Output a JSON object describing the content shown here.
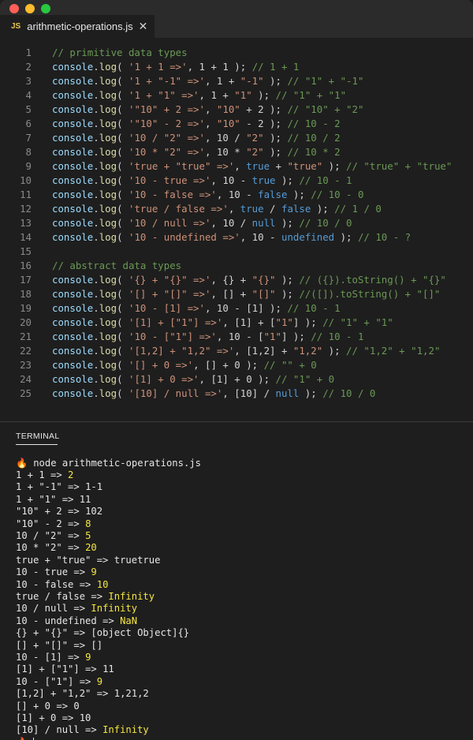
{
  "window": {
    "traffic_lights": [
      {
        "name": "close",
        "color": "#ff5f57"
      },
      {
        "name": "minimize",
        "color": "#febc2e"
      },
      {
        "name": "zoom",
        "color": "#28c840"
      }
    ]
  },
  "tab": {
    "badge": "JS",
    "title": "arithmetic-operations.js",
    "close_icon": "close-icon"
  },
  "editor": {
    "lines": [
      {
        "n": "1",
        "tokens": [
          [
            "c",
            "// primitive data types"
          ]
        ]
      },
      {
        "n": "2",
        "tokens": [
          [
            "i",
            "console"
          ],
          [
            "p",
            "."
          ],
          [
            "f",
            "log"
          ],
          [
            "p",
            "( "
          ],
          [
            "s",
            "'1 + 1 =>'"
          ],
          [
            "p",
            ", "
          ],
          [
            "p",
            "1 + 1"
          ],
          [
            "p",
            " ); "
          ],
          [
            "c",
            "// 1 + 1"
          ]
        ]
      },
      {
        "n": "3",
        "tokens": [
          [
            "i",
            "console"
          ],
          [
            "p",
            "."
          ],
          [
            "f",
            "log"
          ],
          [
            "p",
            "( "
          ],
          [
            "s",
            "'1 + \"-1\" =>'"
          ],
          [
            "p",
            ", "
          ],
          [
            "p",
            "1 + "
          ],
          [
            "s",
            "\"-1\""
          ],
          [
            "p",
            " ); "
          ],
          [
            "c",
            "// \"1\" + \"-1\""
          ]
        ]
      },
      {
        "n": "4",
        "tokens": [
          [
            "i",
            "console"
          ],
          [
            "p",
            "."
          ],
          [
            "f",
            "log"
          ],
          [
            "p",
            "( "
          ],
          [
            "s",
            "'1 + \"1\" =>'"
          ],
          [
            "p",
            ", "
          ],
          [
            "p",
            "1 + "
          ],
          [
            "s",
            "\"1\""
          ],
          [
            "p",
            " ); "
          ],
          [
            "c",
            "// \"1\" + \"1\""
          ]
        ]
      },
      {
        "n": "5",
        "tokens": [
          [
            "i",
            "console"
          ],
          [
            "p",
            "."
          ],
          [
            "f",
            "log"
          ],
          [
            "p",
            "( "
          ],
          [
            "s",
            "'\"10\" + 2 =>'"
          ],
          [
            "p",
            ", "
          ],
          [
            "s",
            "\"10\""
          ],
          [
            "p",
            " + 2 ); "
          ],
          [
            "c",
            "// \"10\" + \"2\""
          ]
        ]
      },
      {
        "n": "6",
        "tokens": [
          [
            "i",
            "console"
          ],
          [
            "p",
            "."
          ],
          [
            "f",
            "log"
          ],
          [
            "p",
            "( "
          ],
          [
            "s",
            "'\"10\" - 2 =>'"
          ],
          [
            "p",
            ", "
          ],
          [
            "s",
            "\"10\""
          ],
          [
            "p",
            " - 2 ); "
          ],
          [
            "c",
            "// 10 - 2"
          ]
        ]
      },
      {
        "n": "7",
        "tokens": [
          [
            "i",
            "console"
          ],
          [
            "p",
            "."
          ],
          [
            "f",
            "log"
          ],
          [
            "p",
            "( "
          ],
          [
            "s",
            "'10 / \"2\" =>'"
          ],
          [
            "p",
            ", "
          ],
          [
            "p",
            "10 / "
          ],
          [
            "s",
            "\"2\""
          ],
          [
            "p",
            " ); "
          ],
          [
            "c",
            "// 10 / 2"
          ]
        ]
      },
      {
        "n": "8",
        "tokens": [
          [
            "i",
            "console"
          ],
          [
            "p",
            "."
          ],
          [
            "f",
            "log"
          ],
          [
            "p",
            "( "
          ],
          [
            "s",
            "'10 * \"2\" =>'"
          ],
          [
            "p",
            ", "
          ],
          [
            "p",
            "10 * "
          ],
          [
            "s",
            "\"2\""
          ],
          [
            "p",
            " ); "
          ],
          [
            "c",
            "// 10 * 2"
          ]
        ]
      },
      {
        "n": "9",
        "tokens": [
          [
            "i",
            "console"
          ],
          [
            "p",
            "."
          ],
          [
            "f",
            "log"
          ],
          [
            "p",
            "( "
          ],
          [
            "s",
            "'true + \"true\" =>'"
          ],
          [
            "p",
            ", "
          ],
          [
            "k",
            "true"
          ],
          [
            "p",
            " + "
          ],
          [
            "s",
            "\"true\""
          ],
          [
            "p",
            " ); "
          ],
          [
            "c",
            "// \"true\" + \"true\""
          ]
        ]
      },
      {
        "n": "10",
        "tokens": [
          [
            "i",
            "console"
          ],
          [
            "p",
            "."
          ],
          [
            "f",
            "log"
          ],
          [
            "p",
            "( "
          ],
          [
            "s",
            "'10 - true =>'"
          ],
          [
            "p",
            ", "
          ],
          [
            "p",
            "10 - "
          ],
          [
            "k",
            "true"
          ],
          [
            "p",
            " ); "
          ],
          [
            "c",
            "// 10 - 1"
          ]
        ]
      },
      {
        "n": "11",
        "tokens": [
          [
            "i",
            "console"
          ],
          [
            "p",
            "."
          ],
          [
            "f",
            "log"
          ],
          [
            "p",
            "( "
          ],
          [
            "s",
            "'10 - false =>'"
          ],
          [
            "p",
            ", "
          ],
          [
            "p",
            "10 - "
          ],
          [
            "k",
            "false"
          ],
          [
            "p",
            " ); "
          ],
          [
            "c",
            "// 10 - 0"
          ]
        ]
      },
      {
        "n": "12",
        "tokens": [
          [
            "i",
            "console"
          ],
          [
            "p",
            "."
          ],
          [
            "f",
            "log"
          ],
          [
            "p",
            "( "
          ],
          [
            "s",
            "'true / false =>'"
          ],
          [
            "p",
            ", "
          ],
          [
            "k",
            "true"
          ],
          [
            "p",
            " / "
          ],
          [
            "k",
            "false"
          ],
          [
            "p",
            " ); "
          ],
          [
            "c",
            "// 1 / 0"
          ]
        ]
      },
      {
        "n": "13",
        "tokens": [
          [
            "i",
            "console"
          ],
          [
            "p",
            "."
          ],
          [
            "f",
            "log"
          ],
          [
            "p",
            "( "
          ],
          [
            "s",
            "'10 / null =>'"
          ],
          [
            "p",
            ", "
          ],
          [
            "p",
            "10 / "
          ],
          [
            "k",
            "null"
          ],
          [
            "p",
            " ); "
          ],
          [
            "c",
            "// 10 / 0"
          ]
        ]
      },
      {
        "n": "14",
        "tokens": [
          [
            "i",
            "console"
          ],
          [
            "p",
            "."
          ],
          [
            "f",
            "log"
          ],
          [
            "p",
            "( "
          ],
          [
            "s",
            "'10 - undefined =>'"
          ],
          [
            "p",
            ", "
          ],
          [
            "p",
            "10 - "
          ],
          [
            "k",
            "undefined"
          ],
          [
            "p",
            " ); "
          ],
          [
            "c",
            "// 10 - ?"
          ]
        ]
      },
      {
        "n": "15",
        "tokens": []
      },
      {
        "n": "16",
        "tokens": [
          [
            "c",
            "// abstract data types"
          ]
        ]
      },
      {
        "n": "17",
        "tokens": [
          [
            "i",
            "console"
          ],
          [
            "p",
            "."
          ],
          [
            "f",
            "log"
          ],
          [
            "p",
            "( "
          ],
          [
            "s",
            "'{} + \"{}\" =>'"
          ],
          [
            "p",
            ", {} + "
          ],
          [
            "s",
            "\"{}\""
          ],
          [
            "p",
            " ); "
          ],
          [
            "c",
            "// ({}).toString() + \"{}\""
          ]
        ]
      },
      {
        "n": "18",
        "tokens": [
          [
            "i",
            "console"
          ],
          [
            "p",
            "."
          ],
          [
            "f",
            "log"
          ],
          [
            "p",
            "( "
          ],
          [
            "s",
            "'[] + \"[]\" =>'"
          ],
          [
            "p",
            ", [] + "
          ],
          [
            "s",
            "\"[]\""
          ],
          [
            "p",
            " ); "
          ],
          [
            "c",
            "//([]).toString() + \"[]\""
          ]
        ]
      },
      {
        "n": "19",
        "tokens": [
          [
            "i",
            "console"
          ],
          [
            "p",
            "."
          ],
          [
            "f",
            "log"
          ],
          [
            "p",
            "( "
          ],
          [
            "s",
            "'10 - [1] =>'"
          ],
          [
            "p",
            ", 10 - [1] ); "
          ],
          [
            "c",
            "// 10 - 1"
          ]
        ]
      },
      {
        "n": "20",
        "tokens": [
          [
            "i",
            "console"
          ],
          [
            "p",
            "."
          ],
          [
            "f",
            "log"
          ],
          [
            "p",
            "( "
          ],
          [
            "s",
            "'[1] + [\"1\"] =>'"
          ],
          [
            "p",
            ", [1] + ["
          ],
          [
            "s",
            "\"1\""
          ],
          [
            "p",
            "] ); "
          ],
          [
            "c",
            "// \"1\" + \"1\""
          ]
        ]
      },
      {
        "n": "21",
        "tokens": [
          [
            "i",
            "console"
          ],
          [
            "p",
            "."
          ],
          [
            "f",
            "log"
          ],
          [
            "p",
            "( "
          ],
          [
            "s",
            "'10 - [\"1\"] =>'"
          ],
          [
            "p",
            ", 10 - ["
          ],
          [
            "s",
            "\"1\""
          ],
          [
            "p",
            "] ); "
          ],
          [
            "c",
            "// 10 - 1"
          ]
        ]
      },
      {
        "n": "22",
        "tokens": [
          [
            "i",
            "console"
          ],
          [
            "p",
            "."
          ],
          [
            "f",
            "log"
          ],
          [
            "p",
            "( "
          ],
          [
            "s",
            "'[1,2] + \"1,2\" =>'"
          ],
          [
            "p",
            ", [1,2] + "
          ],
          [
            "s",
            "\"1,2\""
          ],
          [
            "p",
            " ); "
          ],
          [
            "c",
            "// \"1,2\" + \"1,2\""
          ]
        ]
      },
      {
        "n": "23",
        "tokens": [
          [
            "i",
            "console"
          ],
          [
            "p",
            "."
          ],
          [
            "f",
            "log"
          ],
          [
            "p",
            "( "
          ],
          [
            "s",
            "'[] + 0 =>'"
          ],
          [
            "p",
            ", [] + 0 ); "
          ],
          [
            "c",
            "// \"\" + 0"
          ]
        ]
      },
      {
        "n": "24",
        "tokens": [
          [
            "i",
            "console"
          ],
          [
            "p",
            "."
          ],
          [
            "f",
            "log"
          ],
          [
            "p",
            "( "
          ],
          [
            "s",
            "'[1] + 0 =>'"
          ],
          [
            "p",
            ", [1] + 0 ); "
          ],
          [
            "c",
            "// \"1\" + 0"
          ]
        ]
      },
      {
        "n": "25",
        "tokens": [
          [
            "i",
            "console"
          ],
          [
            "p",
            "."
          ],
          [
            "f",
            "log"
          ],
          [
            "p",
            "( "
          ],
          [
            "s",
            "'[10] / null =>'"
          ],
          [
            "p",
            ", [10] / "
          ],
          [
            "k",
            "null"
          ],
          [
            "p",
            " ); "
          ],
          [
            "c",
            "// 10 / 0"
          ]
        ]
      }
    ]
  },
  "panel": {
    "title": "TERMINAL"
  },
  "terminal": {
    "prompt_icon": "flame-icon",
    "command": "node arithmetic-operations.js",
    "outputs": [
      {
        "expr": "1 + 1 => ",
        "result": "2",
        "highlight": true
      },
      {
        "expr": "1 + \"-1\" => ",
        "result": "1-1",
        "highlight": false
      },
      {
        "expr": "1 + \"1\" => ",
        "result": "11",
        "highlight": false
      },
      {
        "expr": "\"10\" + 2 => ",
        "result": "102",
        "highlight": false
      },
      {
        "expr": "\"10\" - 2 => ",
        "result": "8",
        "highlight": true
      },
      {
        "expr": "10 / \"2\" => ",
        "result": "5",
        "highlight": true
      },
      {
        "expr": "10 * \"2\" => ",
        "result": "20",
        "highlight": true
      },
      {
        "expr": "true + \"true\" => ",
        "result": "truetrue",
        "highlight": false
      },
      {
        "expr": "10 - true => ",
        "result": "9",
        "highlight": true
      },
      {
        "expr": "10 - false => ",
        "result": "10",
        "highlight": true
      },
      {
        "expr": "true / false => ",
        "result": "Infinity",
        "highlight": true
      },
      {
        "expr": "10 / null => ",
        "result": "Infinity",
        "highlight": true
      },
      {
        "expr": "10 - undefined => ",
        "result": "NaN",
        "highlight": true
      },
      {
        "expr": "{} + \"{}\" => ",
        "result": "[object Object]{}",
        "highlight": false
      },
      {
        "expr": "[] + \"[]\" => ",
        "result": "[]",
        "highlight": false
      },
      {
        "expr": "10 - [1] => ",
        "result": "9",
        "highlight": true
      },
      {
        "expr": "[1] + [\"1\"] => ",
        "result": "11",
        "highlight": false
      },
      {
        "expr": "10 - [\"1\"] => ",
        "result": "9",
        "highlight": true
      },
      {
        "expr": "[1,2] + \"1,2\" => ",
        "result": "1,21,2",
        "highlight": false
      },
      {
        "expr": "[] + 0 => ",
        "result": "0",
        "highlight": false
      },
      {
        "expr": "[1] + 0 => ",
        "result": "10",
        "highlight": false
      },
      {
        "expr": "[10] / null => ",
        "result": "Infinity",
        "highlight": true
      }
    ]
  }
}
